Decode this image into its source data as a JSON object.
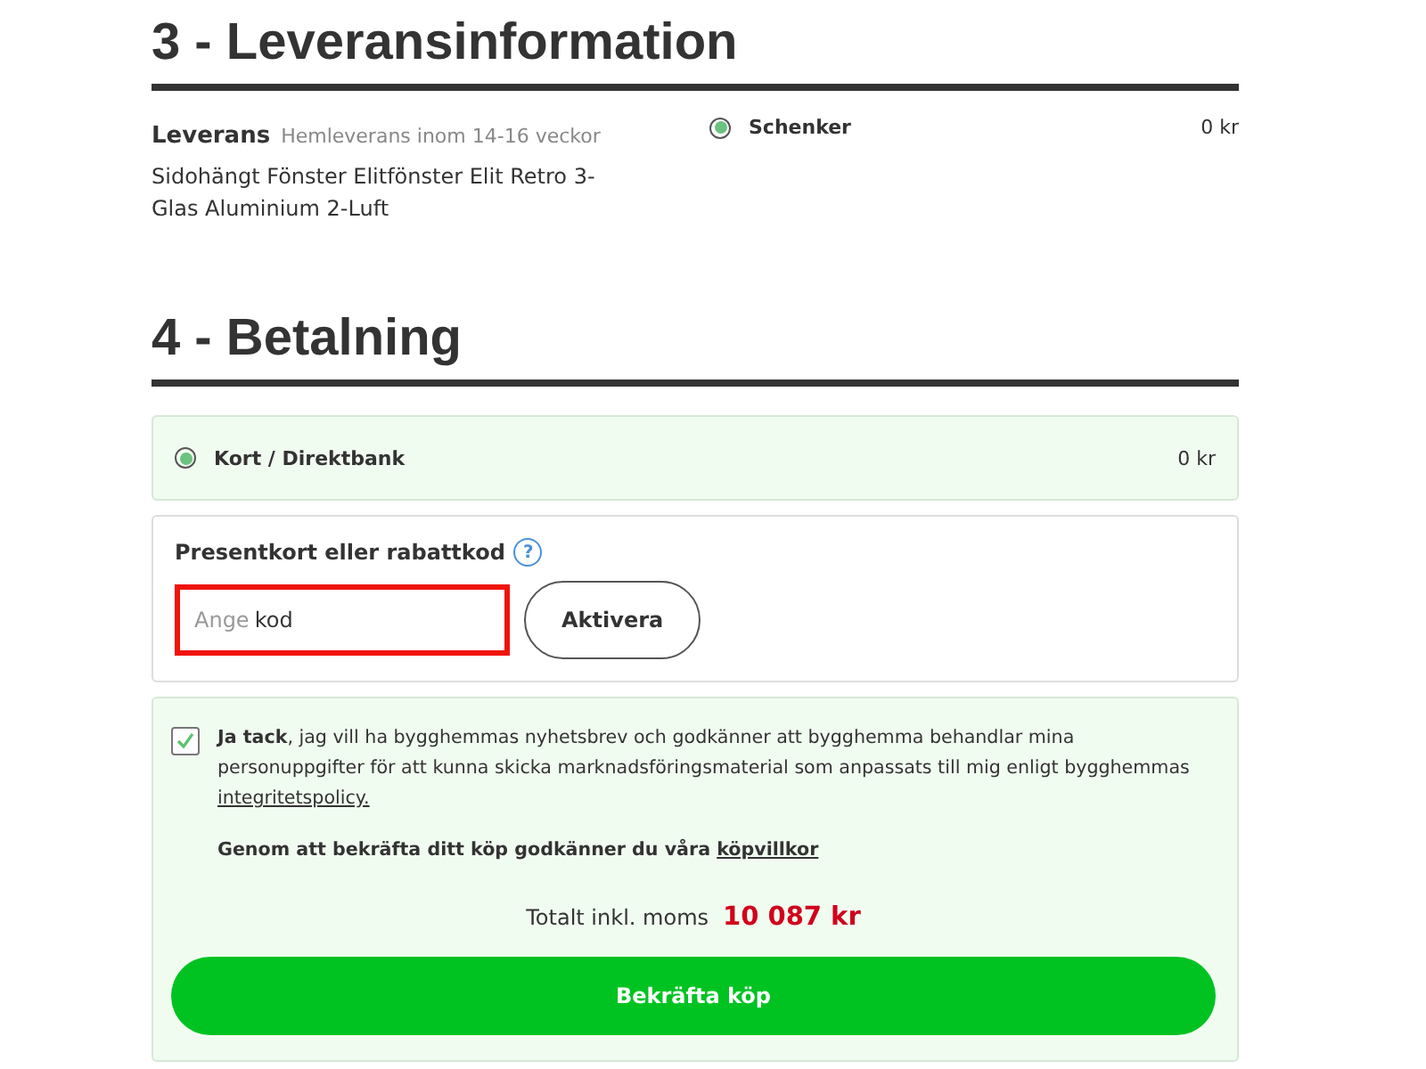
{
  "delivery_section": {
    "heading": "3 - Leveransinformation",
    "label": "Leverans",
    "note": "Hemleverans inom 14-16 veckor",
    "product": "Sidohängt Fönster Elitfönster Elit Retro 3-Glas Aluminium 2-Luft",
    "options": [
      {
        "name": "Schenker",
        "price": "0 kr",
        "selected": true
      }
    ]
  },
  "payment_section": {
    "heading": "4 - Betalning",
    "options": [
      {
        "name": "Kort / Direktbank",
        "price": "0 kr",
        "selected": true
      }
    ],
    "voucher": {
      "label": "Presentkort eller rabattkod",
      "help": "?",
      "field": {
        "placeholder": "Ange",
        "value": "kod",
        "highlighted": true
      },
      "button": "Aktivera"
    },
    "consent": {
      "checked": true,
      "text": "**Ja tack**, jag vill ha bygghemmas nyhetsbrev och godkänner att bygghemma behandlar mina personuppgifter för att kunna skicka marknadsföringsmaterial som anpassats till mig enligt bygghemmas ",
      "link": "integritetspolicy."
    },
    "terms": {
      "text": "Genom att bekräfta ditt köp godkänner du våra ",
      "link": "köpvillkor"
    },
    "total": {
      "label": "Totalt inkl. moms",
      "amount": "10 087 kr"
    },
    "confirm_button": "Bekräfta köp"
  }
}
